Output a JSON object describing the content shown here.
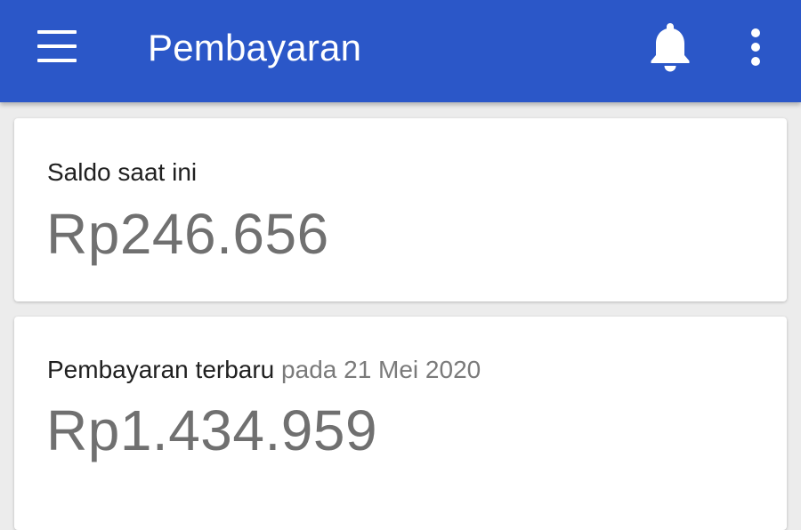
{
  "appbar": {
    "title": "Pembayaran",
    "background_color": "#2b57c8",
    "menu_icon": "hamburger-menu-icon",
    "notification_icon": "bell-icon",
    "overflow_icon": "more-vert-icon"
  },
  "balance_card": {
    "label": "Saldo saat ini",
    "amount": "Rp246.656"
  },
  "payment_card": {
    "label": "Pembayaran terbaru",
    "date_text": "pada 21 Mei 2020",
    "amount": "Rp1.434.959"
  }
}
